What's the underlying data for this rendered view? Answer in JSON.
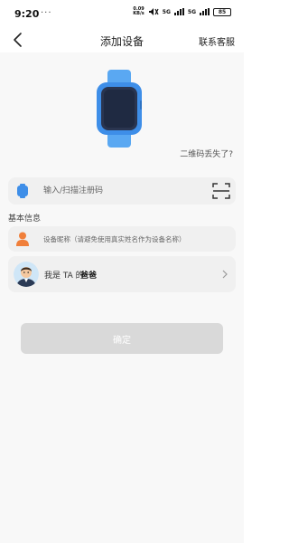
{
  "status_bar": {
    "time": "9:20",
    "left_dots": "···",
    "speed_value": "0.09",
    "speed_unit": "KB/s",
    "network_1": "5G",
    "network_2": "5G",
    "battery": "85"
  },
  "header": {
    "title": "添加设备",
    "service_label": "联系客服"
  },
  "device": {
    "lost_qr_label": "二维码丢失了?"
  },
  "registration": {
    "placeholder": "输入/扫描注册码",
    "value": ""
  },
  "basic_info": {
    "section_label": "基本信息",
    "nickname_placeholder": "设备昵称（请避免使用真实姓名作为设备名称）",
    "nickname_value": ""
  },
  "relationship": {
    "prefix": "我是 TA 的",
    "value": "爸爸"
  },
  "actions": {
    "confirm_label": "确定"
  },
  "colors": {
    "accent_blue": "#3e8ee8",
    "person_orange": "#f07f3a",
    "disabled_button": "#d9d9d9"
  }
}
